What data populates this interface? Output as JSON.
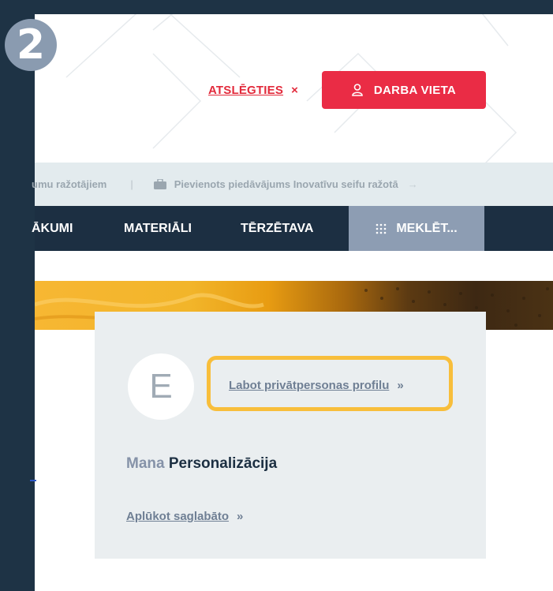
{
  "step": {
    "number": "2"
  },
  "header": {
    "logout_label": "ATSLĒGTIES",
    "logout_close": "×",
    "workplace_label": "DARBA VIETA",
    "workplace_icon": "user-icon"
  },
  "ticker": {
    "item1": "umu ražotājiem",
    "separator": "|",
    "item2": "Pievienots piedāvājums Inovatīvu seifu ražotā",
    "item2_icon": "briefcase-icon",
    "arrow": "→"
  },
  "nav": {
    "items": [
      "ĀKUMI",
      "MATERIĀLI",
      "TĒRZĒTAVA"
    ],
    "search_label": "MEKLĒT...",
    "search_icon": "grid-dots-icon"
  },
  "profile": {
    "avatar_letter": "E",
    "edit_link": "Labot privātpersonas profilu",
    "chevron": "»",
    "title_light": "Mana",
    "title_dark": "Personalizācija",
    "view_saved": "Aplūkot saglabāto"
  },
  "colors": {
    "frame": "#1e3345",
    "accent_red": "#ea2c45",
    "highlight": "#f8be3b",
    "navbar": "#1c2f42",
    "search_bg": "#8d9db3"
  }
}
